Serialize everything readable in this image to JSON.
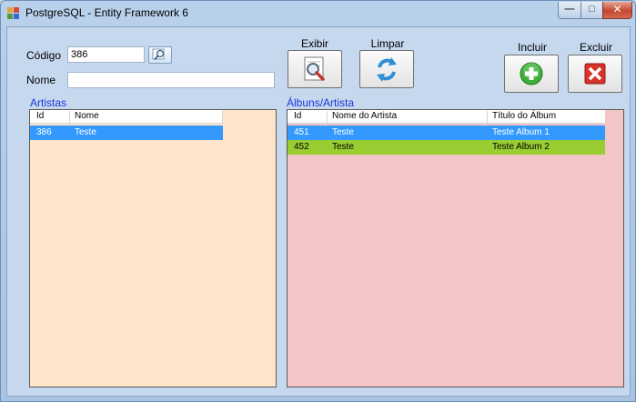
{
  "window": {
    "title": "PostgreSQL - Entity Framework 6",
    "controls": {
      "minimize": "—",
      "maximize": "□",
      "close": "✕"
    }
  },
  "form": {
    "codigo_label": "Código",
    "codigo_value": "386",
    "nome_label": "Nome",
    "nome_value": ""
  },
  "buttons": {
    "exibir": "Exibir",
    "limpar": "Limpar",
    "incluir": "Incluir",
    "excluir": "Excluir"
  },
  "artistas": {
    "title": "Artistas",
    "columns": [
      "Id",
      "Nome"
    ],
    "rows": [
      {
        "id": "386",
        "nome": "Teste"
      }
    ]
  },
  "albuns": {
    "title": "Álbuns/Artista",
    "columns": [
      "Id",
      "Nome do Artista",
      "Título do Álbum"
    ],
    "rows": [
      {
        "id": "451",
        "artista": "Teste",
        "titulo": "Teste Album 1"
      },
      {
        "id": "452",
        "artista": "Teste",
        "titulo": "Teste Album 2"
      }
    ]
  },
  "colors": {
    "selected_row": "#3399ff",
    "highlight_row": "#9acd32",
    "artistas_bg": "#fde4cb",
    "albuns_bg": "#f4c5c6",
    "group_title": "#1f36d6"
  }
}
